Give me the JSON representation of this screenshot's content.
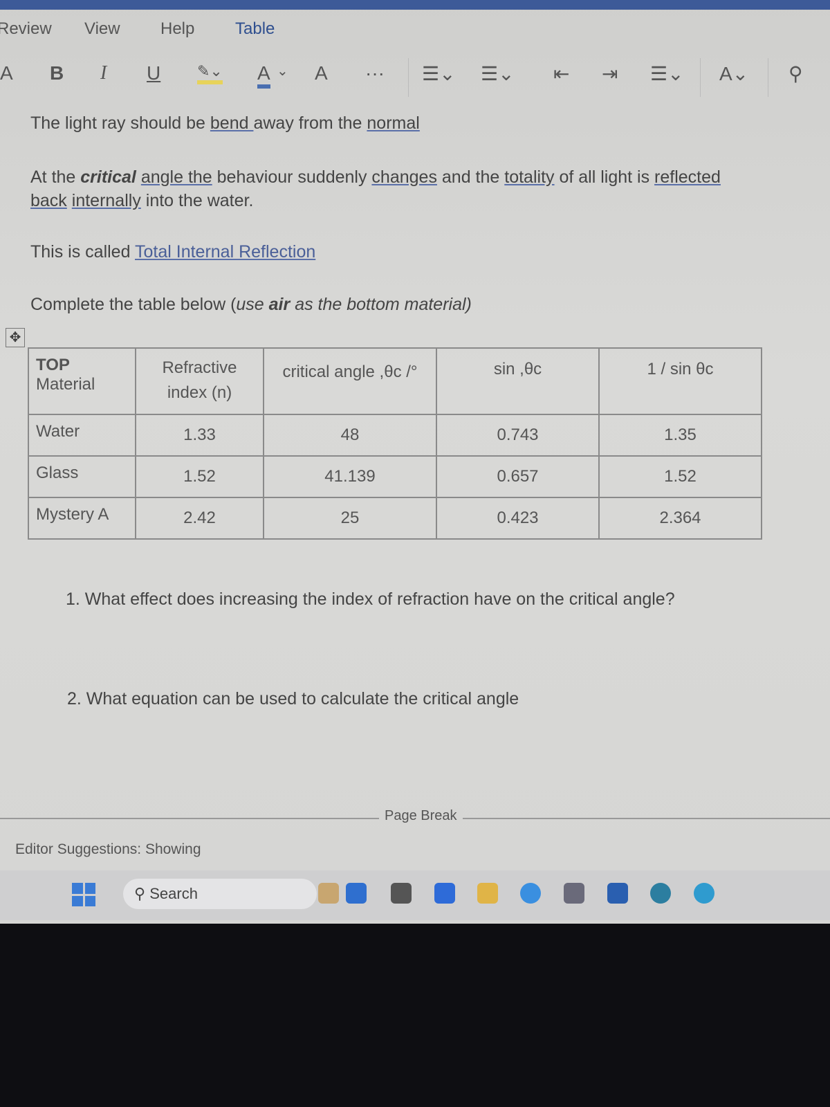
{
  "menu": {
    "items": [
      "Review",
      "View",
      "Help",
      "Table"
    ]
  },
  "toolbar": {
    "font_size": "A",
    "bold": "B",
    "italic": "I",
    "underline": "U",
    "highlight": "A",
    "font_color": "A",
    "clear_format": "A",
    "more": "···"
  },
  "doc": {
    "line1": {
      "a": "The light ray should be ",
      "b": "bend ",
      "c": "away from the ",
      "d": "normal"
    },
    "line2": {
      "a": "At the ",
      "b": "critical",
      " c": "",
      "c2": "angle  the",
      "d": " behaviour suddenly ",
      "e": "changes",
      "f": " and the ",
      "g": "totality",
      "h": " of all light is ",
      "i": "reflected"
    },
    "line3": {
      "a": "back",
      "b": " ",
      "c": "internally",
      "d": " into the water."
    },
    "line4": {
      "a": "This is called ",
      "b": "Total Internal Reflection "
    },
    "line5": {
      "a": "Complete the table below (",
      "b": "use ",
      "c": "air",
      "d": " as the bottom material)"
    }
  },
  "table": {
    "headers": [
      [
        "TOP",
        "Material"
      ],
      [
        "Refractive",
        "index (n)"
      ],
      [
        "critical angle ,θc /°"
      ],
      [
        "sin ,θc"
      ],
      [
        "1 / sin θc"
      ]
    ],
    "rows": [
      [
        "Water",
        "1.33",
        "48",
        "0.743",
        "1.35"
      ],
      [
        "Glass",
        "1.52",
        "41.139",
        "0.657",
        "1.52"
      ],
      [
        "Mystery A",
        "2.42",
        "25",
        "0.423",
        "2.364"
      ]
    ]
  },
  "questions": [
    "1.  What effect does increasing the index of refraction have on the critical angle?",
    "2.  What equation can be used to calculate the critical angle"
  ],
  "page_break": "Page Break",
  "status": "Editor Suggestions: Showing",
  "taskbar": {
    "search": "Search"
  },
  "colors": {
    "accent": "#3d5a98",
    "background": "#d6d6d4"
  }
}
